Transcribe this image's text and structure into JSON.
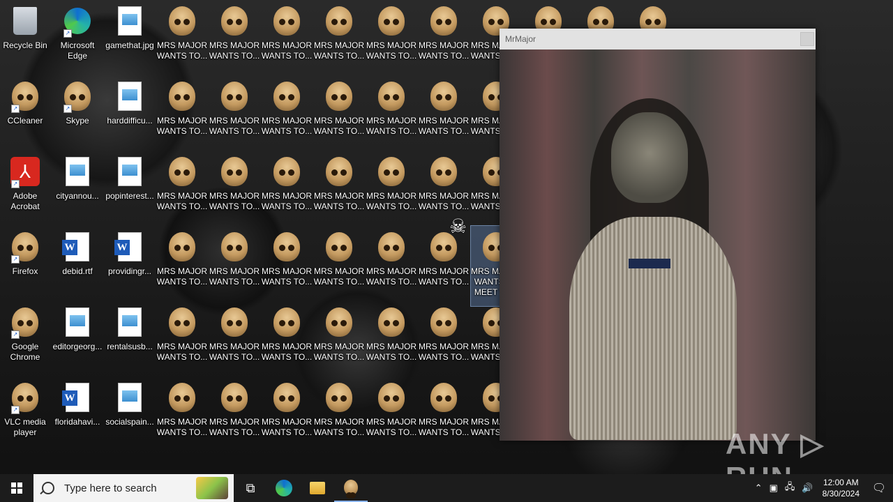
{
  "desktop": {
    "col1": [
      "Recycle Bin",
      "CCleaner",
      "Adobe Acrobat",
      "Firefox",
      "Google Chrome",
      "VLC media player"
    ],
    "col2": [
      "Microsoft Edge",
      "Skype",
      "cityannou...",
      "debid.rtf",
      "editorgeorg...",
      "floridahavi..."
    ],
    "col3": [
      "gamethat.jpg",
      "harddifficu...",
      "popinterest...",
      "providingr...",
      "rentalsusb...",
      "socialspain..."
    ],
    "mrs_label": "MRS MAJOR WANTS TO...",
    "selected_label": "MRS MAJOR WANTS TO MEET YOU"
  },
  "window": {
    "title": "MrMajor"
  },
  "watermark": "ANY ▷ RUN",
  "taskbar": {
    "search_placeholder": "Type here to search",
    "time": "12:00 AM",
    "date": "8/30/2024"
  }
}
